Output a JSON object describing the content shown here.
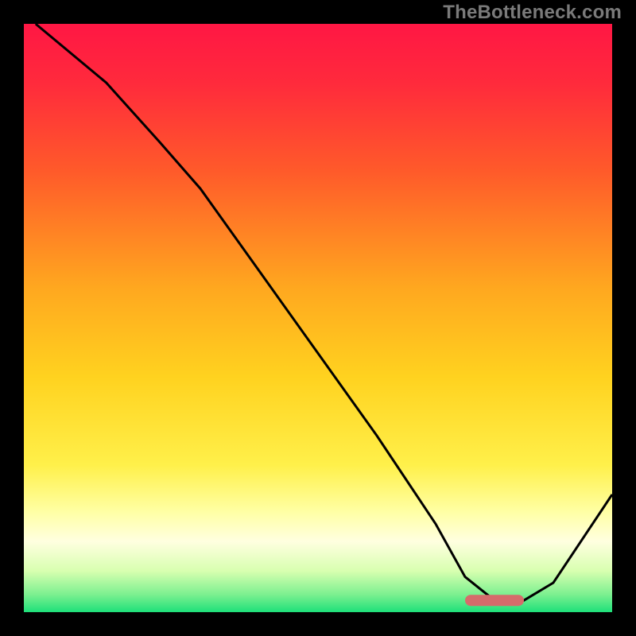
{
  "watermark": "TheBottleneck.com",
  "colors": {
    "bg": "#000000",
    "watermark": "#7a7a7a",
    "curve": "#000000",
    "marker_fill": "#d66b6b",
    "marker_stroke": "none",
    "gradient_stops": [
      {
        "offset": 0.0,
        "color": "#ff1744"
      },
      {
        "offset": 0.1,
        "color": "#ff2a3c"
      },
      {
        "offset": 0.25,
        "color": "#ff5a2a"
      },
      {
        "offset": 0.45,
        "color": "#ffa81f"
      },
      {
        "offset": 0.6,
        "color": "#ffd21f"
      },
      {
        "offset": 0.75,
        "color": "#fff04a"
      },
      {
        "offset": 0.83,
        "color": "#ffffa5"
      },
      {
        "offset": 0.88,
        "color": "#ffffe0"
      },
      {
        "offset": 0.93,
        "color": "#d8ffb0"
      },
      {
        "offset": 0.97,
        "color": "#7cf090"
      },
      {
        "offset": 1.0,
        "color": "#1ee07a"
      }
    ]
  },
  "chart_data": {
    "type": "line",
    "title": "",
    "xlabel": "",
    "ylabel": "",
    "xlim": [
      0,
      100
    ],
    "ylim": [
      0,
      100
    ],
    "grid": false,
    "series": [
      {
        "name": "bottleneck-curve",
        "x": [
          2,
          14,
          23,
          30,
          40,
          50,
          60,
          70,
          75,
          80,
          85,
          90,
          100
        ],
        "values": [
          100,
          90,
          80,
          72,
          58,
          44,
          30,
          15,
          6,
          2,
          2,
          5,
          20
        ]
      }
    ],
    "marker": {
      "name": "optimal-range",
      "x_start": 75,
      "x_end": 85,
      "y": 2
    }
  }
}
